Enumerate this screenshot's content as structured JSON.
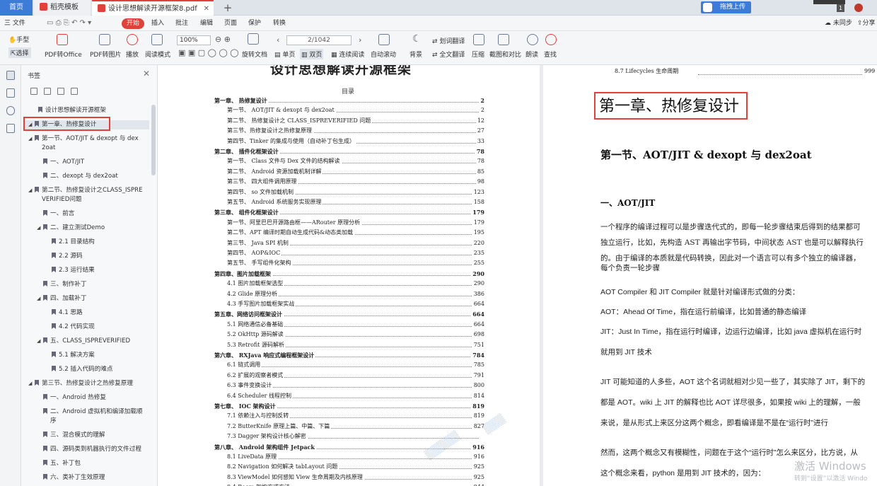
{
  "tabs": {
    "home": "首页",
    "wps": "稻壳模板",
    "doc": "设计思想解读开源框架8.pdf",
    "close": "✕",
    "plus": "+"
  },
  "header_right": {
    "upload": "拖拽上传",
    "badge": "1"
  },
  "menu": {
    "file": "三 文件",
    "items": [
      "开始",
      "插入",
      "批注",
      "编辑",
      "页面",
      "保护",
      "转换"
    ],
    "sync": "未同步",
    "share": "分享"
  },
  "toolbar": {
    "hand": "手型",
    "select": "选择",
    "pdf_to_office": "PDF转Office",
    "pdf_to_image": "PDF转图片",
    "play": "播放",
    "read_mode": "阅读模式",
    "zoom": "100%",
    "rotate": "旋转文档",
    "single": "单页",
    "double": "双页",
    "continuous": "连续阅读",
    "page": "2/1042",
    "autoscroll": "自动滚动",
    "background": "背景",
    "translate_word": "划词翻译",
    "translate_full": "全文翻译",
    "compress": "压缩",
    "screenshot": "截图和对比",
    "read_aloud": "朗读",
    "search": "查找"
  },
  "sidebar": {
    "title": "书签",
    "items": [
      {
        "label": "设计思想解读开源框架",
        "level": 0,
        "tri": ""
      },
      {
        "label": "第一章、热修复设计",
        "level": 0,
        "tri": "◢"
      },
      {
        "label": "第一节、AOT/JIT & dexopt 与 dex",
        "label2": "2oat",
        "level": 1,
        "tri": "◢"
      },
      {
        "label": "一、AOT/JIT",
        "level": 2,
        "tri": ""
      },
      {
        "label": "二、dexopt 与 dex2oat",
        "level": 2,
        "tri": ""
      },
      {
        "label": "第二节、热修复设计之CLASS_ISPRE",
        "label2": "VERIFIED问题",
        "level": 1,
        "tri": "◢"
      },
      {
        "label": "一、前言",
        "level": 2,
        "tri": ""
      },
      {
        "label": "二、建立测试Demo",
        "level": 2,
        "tri": "◢"
      },
      {
        "label": "2.1 目录结构",
        "level": 3,
        "tri": ""
      },
      {
        "label": "2.2 源码",
        "level": 3,
        "tri": ""
      },
      {
        "label": "2.3 运行结果",
        "level": 3,
        "tri": ""
      },
      {
        "label": "三、制作补丁",
        "level": 2,
        "tri": ""
      },
      {
        "label": "四、加载补丁",
        "level": 2,
        "tri": "◢"
      },
      {
        "label": "4.1 思路",
        "level": 3,
        "tri": ""
      },
      {
        "label": "4.2 代码实现",
        "level": 3,
        "tri": ""
      },
      {
        "label": "五、CLASS_ISPREVERIFIED",
        "level": 2,
        "tri": "◢"
      },
      {
        "label": "5.1 解决方案",
        "level": 3,
        "tri": ""
      },
      {
        "label": "5.2 插入代码的难点",
        "level": 3,
        "tri": ""
      },
      {
        "label": "第三节、热修复设计之热修复原理",
        "level": 1,
        "tri": "◢"
      },
      {
        "label": "一、Android 热修复",
        "level": 2,
        "tri": ""
      },
      {
        "label": "二、Android 虚拟机和编译加载顺",
        "label2": "序",
        "level": 2,
        "tri": ""
      },
      {
        "label": "三、混合模式的理解",
        "level": 2,
        "tri": ""
      },
      {
        "label": "四、源码类到机器执行的文件过程",
        "level": 2,
        "tri": ""
      },
      {
        "label": "五、补丁包",
        "level": 2,
        "tri": ""
      },
      {
        "label": "六、类补丁生效原理",
        "level": 2,
        "tri": ""
      }
    ]
  },
  "page1": {
    "title": "设计思想解读开源框架",
    "toc_label": "目录",
    "toc": [
      {
        "t": "第一章、  热修复设计",
        "p": "2",
        "bold": true,
        "ind": 0
      },
      {
        "t": "第一节、  AOT/JIT & dexopt  与  dex2oat",
        "p": "2",
        "ind": 1
      },
      {
        "t": "第二节、  热修复设计之 CLASS_ISPREVERIFIED 问题",
        "p": "12",
        "ind": 1
      },
      {
        "t": "第三节、热修复设计之热修复原理",
        "p": "27",
        "ind": 1
      },
      {
        "t": "第四节、Tinker 的集成与使用（自动补丁包生成）",
        "p": "33",
        "ind": 1
      },
      {
        "t": "第二章、  插件化框架设计",
        "p": "78",
        "bold": true,
        "ind": 0
      },
      {
        "t": "第一节、  Class 文件与 Dex 文件的结构解读",
        "p": "78",
        "ind": 1
      },
      {
        "t": "第二节、  Android 资源加载机制详解",
        "p": "85",
        "ind": 1
      },
      {
        "t": "第三节、  四大组件调用原理",
        "p": "98",
        "ind": 1
      },
      {
        "t": "第四节、  so 文件加载机制",
        "p": "123",
        "ind": 1
      },
      {
        "t": "第五节、  Android 系统服务实现原理",
        "p": "158",
        "ind": 1
      },
      {
        "t": "第三章、  组件化框架设计",
        "p": "179",
        "bold": true,
        "ind": 0
      },
      {
        "t": "第一节、阿里巴巴开源路由框——ARouter 原理分析",
        "p": "179",
        "ind": 1
      },
      {
        "t": "第二节、APT 编译时期自动生成代码&动态类加载",
        "p": "195",
        "ind": 1
      },
      {
        "t": "第三节、  Java SPI 机制",
        "p": "220",
        "ind": 1
      },
      {
        "t": "第四节、  AOP&IOC",
        "p": "235",
        "ind": 1
      },
      {
        "t": "第五节、  手写组件化架构",
        "p": "255",
        "ind": 1
      },
      {
        "t": "第四章、图片加载框架",
        "p": "290",
        "bold": true,
        "ind": 0
      },
      {
        "t": "4.1 图片加载框架选型",
        "p": "290",
        "ind": 1
      },
      {
        "t": "4.2 Glide 原理分析",
        "p": "386",
        "ind": 1
      },
      {
        "t": "4.3 手写图片加载框架实战",
        "p": "664",
        "ind": 1
      },
      {
        "t": "第五章、网络访问框架设计",
        "p": "664",
        "bold": true,
        "ind": 0
      },
      {
        "t": "5.1 网络通信必备基础",
        "p": "664",
        "ind": 1
      },
      {
        "t": "5.2 OkHttp 源码解读",
        "p": "698",
        "ind": 1
      },
      {
        "t": "5.3  Retrofit 源码解析",
        "p": "751",
        "ind": 1
      },
      {
        "t": "第六章、  RXJava 响应式编程框架设计",
        "p": "784",
        "bold": true,
        "ind": 0
      },
      {
        "t": "6.1  链式调用",
        "p": "785",
        "ind": 1
      },
      {
        "t": "6.2  扩展的观察者模式",
        "p": "791",
        "ind": 1
      },
      {
        "t": "6.3  事件变换设计",
        "p": "800",
        "ind": 1
      },
      {
        "t": "6.4  Scheduler 线程控制",
        "p": "814",
        "ind": 1
      },
      {
        "t": "第七章、  IOC 架构设计",
        "p": "819",
        "bold": true,
        "ind": 0
      },
      {
        "t": "7.1  依赖注入与控制反转",
        "p": "819",
        "ind": 1
      },
      {
        "t": "7.2 ButterKnife 原理上篇、中篇、下篇",
        "p": "827",
        "ind": 1
      },
      {
        "t": "7.3  Dagger 架构设计核心解密",
        "p": "",
        "ind": 1
      },
      {
        "t": "第八章、  Android 架构组件 Jetpack",
        "p": "916",
        "bold": true,
        "ind": 0
      },
      {
        "t": "8.1  LiveData 原理",
        "p": "916",
        "ind": 1
      },
      {
        "t": "8.2 Navigation 如何解决 tabLayout 问题",
        "p": "925",
        "ind": 1
      },
      {
        "t": "8.3  ViewModel 如何感知 View 生命周期及内核原理",
        "p": "925",
        "ind": 1
      },
      {
        "t": "8.4  Room 架构方式方法",
        "p": "944",
        "ind": 1
      }
    ]
  },
  "page2": {
    "top_line": "8.7  Lifecycles 生命周期",
    "top_page": "999",
    "chapter": "第一章、热修复设计",
    "section": "第一节、AOT/JIT & dexopt 与 dex2oat",
    "sub": "一、AOT/JIT",
    "p1": [
      "一个程序的编译过程可以是步骤迭代式的，即每一轮步骤结束后得到的结果都可",
      "独立运行，比如，先构造 AST 再输出字节码，中间状态 AST 也是可以解释执行",
      "的。由于编译的本质就是代码转换，因此对一个语言可以有多个独立的编译器，",
      "每个负责一轮步骤"
    ],
    "p2": "AOT Compiler 和 JIT Compiler 就是针对编译形式做的分类：",
    "p3": "AOT：Ahead Of Time，指在运行前编译，比如普通的静态编译",
    "p4": [
      "JIT：Just In Time，指在运行时编译，边运行边编译，比如 java 虚拟机在运行时",
      "就用到 JIT 技术"
    ],
    "p5": [
      "JIT 可能知道的人多些，AOT 这个名词就相对少见一些了，其实除了 JIT，剩下的",
      "都是 AOT。wiki 上 JIT 的解释也比 AOT 详尽很多，如果按 wiki 上的理解，一般",
      "来说，是从形式上来区分这两个概念，即看编译是不是在“运行时”进行"
    ],
    "p6": [
      "然而，这两个概念又有模糊性，问题在于这个“运行时”怎么来区分，比方说，从",
      "这个概念来看，python 是用到 JIT 技术的，因为："
    ]
  },
  "os": {
    "activate1": "激活 Windows",
    "activate2": "转到“设置”以激活 Windo"
  }
}
